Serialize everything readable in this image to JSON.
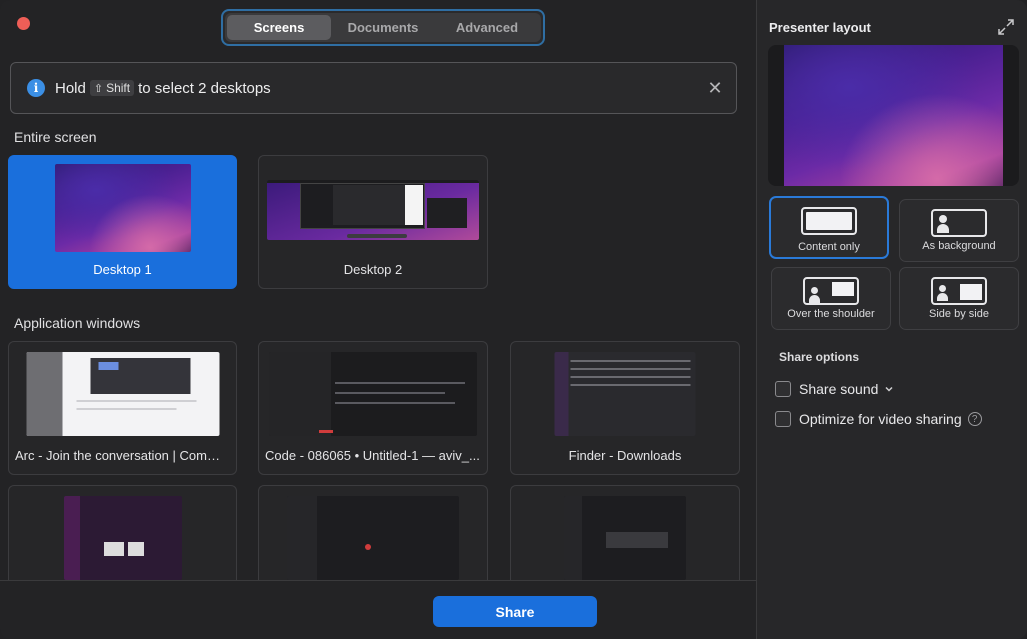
{
  "tabs": [
    {
      "label": "Screens",
      "active": true
    },
    {
      "label": "Documents",
      "active": false
    },
    {
      "label": "Advanced",
      "active": false
    }
  ],
  "info": {
    "prefix": "Hold",
    "key_glyph": "⇧",
    "key": "Shift",
    "suffix": "to select 2 desktops"
  },
  "sections": {
    "entire_screen": "Entire screen",
    "application_windows": "Application windows"
  },
  "screens": [
    {
      "label": "Desktop 1",
      "selected": true
    },
    {
      "label": "Desktop 2",
      "selected": false
    }
  ],
  "apps": [
    {
      "label": "Arc - Join the conversation | Commu..."
    },
    {
      "label": "Code - 086065 • Untitled-1 — aviv_..."
    },
    {
      "label": "Finder - Downloads"
    }
  ],
  "share_button": "Share",
  "presenter": {
    "title": "Presenter layout",
    "options": [
      {
        "label": "Content only",
        "selected": true
      },
      {
        "label": "As background",
        "selected": false
      },
      {
        "label": "Over the shoulder",
        "selected": false
      },
      {
        "label": "Side by side",
        "selected": false
      }
    ]
  },
  "share_options": {
    "title": "Share options",
    "sound": "Share sound",
    "optimize": "Optimize for video sharing",
    "help": "?"
  },
  "colors": {
    "accent": "#1a6fdc",
    "background": "#232325",
    "close": "#ee5e57"
  }
}
